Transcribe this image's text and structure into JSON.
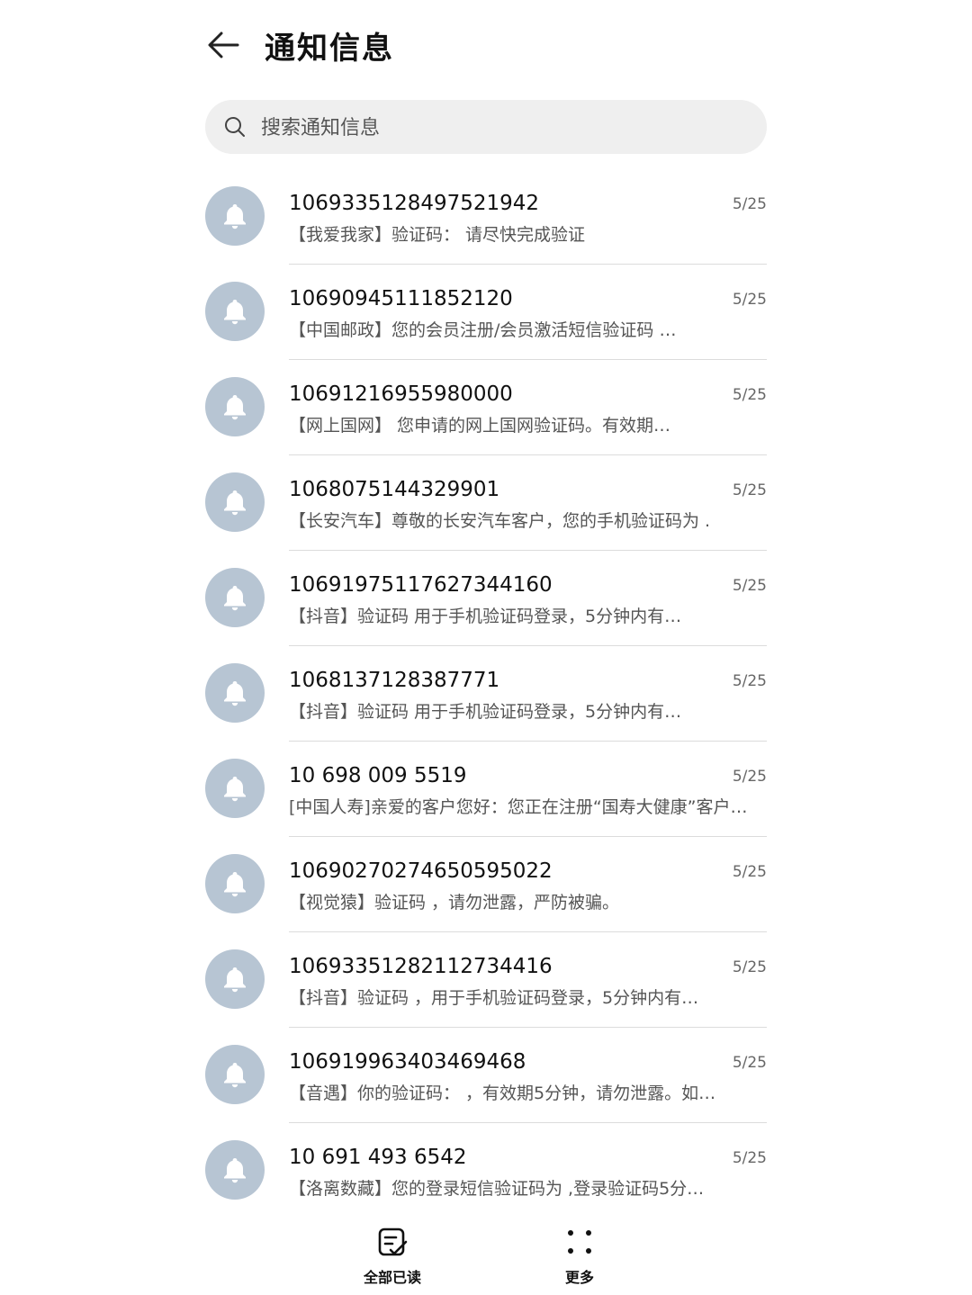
{
  "header": {
    "title": "通知信息"
  },
  "search": {
    "placeholder": "搜索通知信息"
  },
  "messages": [
    {
      "sender": "1069335128497521942",
      "date": "5/25",
      "preview": "【我爱我家】验证码：          请尽快完成验证"
    },
    {
      "sender": "10690945111852120",
      "date": "5/25",
      "preview": "【中国邮政】您的会员注册/会员激活短信验证码                    …"
    },
    {
      "sender": "10691216955980000",
      "date": "5/25",
      "preview": "【网上国网】          您申请的网上国网验证码。有效期…"
    },
    {
      "sender": "1068075144329901",
      "date": "5/25",
      "preview": "【长安汽车】尊敬的长安汽车客户，您的手机验证码为          ."
    },
    {
      "sender": "10691975117627344160",
      "date": "5/25",
      "preview": "【抖音】验证码          用于手机验证码登录，5分钟内有…"
    },
    {
      "sender": "1068137128387771",
      "date": "5/25",
      "preview": "【抖音】验证码          用于手机验证码登录，5分钟内有…"
    },
    {
      "sender": "10 698 009 5519",
      "date": "5/25",
      "preview": "[中国人寿]亲爱的客户您好：您正在注册“国寿大健康”客户…"
    },
    {
      "sender": "10690270274650595022",
      "date": "5/25",
      "preview": "【视觉猿】验证码        ，请勿泄露，严防被骗。"
    },
    {
      "sender": "10693351282112734416",
      "date": "5/25",
      "preview": "【抖音】验证码          ，用于手机验证码登录，5分钟内有…"
    },
    {
      "sender": "106919963403469468",
      "date": "5/25",
      "preview": "【音遇】你的验证码：        ，有效期5分钟，请勿泄露。如…"
    },
    {
      "sender": "10 691 493 6542",
      "date": "5/25",
      "preview": "【洛离数藏】您的登录短信验证码为          ,登录验证码5分…"
    }
  ],
  "bottom_bar": {
    "read_all_label": "全部已读",
    "more_label": "更多"
  },
  "icons": {
    "back": "arrow-left-icon",
    "search": "search-icon",
    "avatar": "bell-icon",
    "read_all": "mark-read-icon",
    "more": "dots-grid-icon"
  },
  "colors": {
    "avatar_bg": "#b7c5d3",
    "search_bg": "#efefef"
  }
}
